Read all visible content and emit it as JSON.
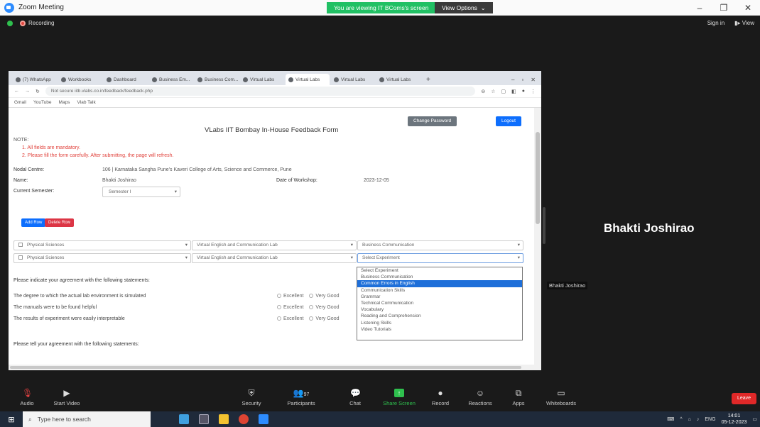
{
  "zoom": {
    "window_title": "Zoom Meeting",
    "viewing_banner": "You are viewing IT BComs's screen",
    "view_options": "View Options",
    "recording": "Recording",
    "sign_in": "Sign in",
    "view": "View",
    "speaker_name": "Bhakti Joshirao",
    "thumbnail_name": "Bhakti Joshirao",
    "toolbar": [
      {
        "label": "Audio",
        "icon": "mic-icon"
      },
      {
        "label": "Start Video",
        "icon": "video-icon"
      },
      {
        "label": "Security",
        "icon": "shield-icon"
      },
      {
        "label": "Participants",
        "icon": "participants-icon",
        "count": "97"
      },
      {
        "label": "Chat",
        "icon": "chat-icon"
      },
      {
        "label": "Share Screen",
        "icon": "share-icon"
      },
      {
        "label": "Record",
        "icon": "record-icon"
      },
      {
        "label": "Reactions",
        "icon": "reactions-icon"
      },
      {
        "label": "Apps",
        "icon": "apps-icon"
      },
      {
        "label": "Whiteboards",
        "icon": "whiteboard-icon"
      }
    ],
    "leave": "Leave"
  },
  "browser": {
    "tabs": [
      "(7) WhatsApp",
      "Workbooks",
      "Dashboard",
      "Business Em...",
      "Business Com...",
      "Virtual Labs",
      "Virtual Labs",
      "Virtual Labs",
      "Virtual Labs"
    ],
    "url": "Not secure  iitb.vlabs.co.in/feedback/feedback.php",
    "bookmarks": [
      "Gmail",
      "YouTube",
      "Maps",
      "Vlab Talk"
    ]
  },
  "form": {
    "change_password": "Change Password",
    "logout": "Logout",
    "title": "VLabs IIT Bombay In-House Feedback Form",
    "note_label": "NOTE:",
    "note_1": "1. All fields are mandatory.",
    "note_2": "2. Please fill the form carefully. After submitting, the page will refresh.",
    "nodal_label": "Nodal Centre:",
    "nodal_value": "106 | Karnataka Sangha Pune's Kaveri College of Arts, Science and Commerce, Pune",
    "name_label": "Name:",
    "name_value": "Bhakti Joshirao",
    "date_label": "Date of Workshop:",
    "date_value": "2023-12-05",
    "semester_label": "Current Semester:",
    "semester_value": "Semester I",
    "add_row": "Add Row",
    "delete_row": "Delete Row",
    "rows": [
      {
        "discipline": "Physical Sciences",
        "lab": "Virtual English and Communication Lab",
        "experiment": "Business Communication"
      },
      {
        "discipline": "Physical Sciences",
        "lab": "Virtual English and Communication Lab",
        "experiment": "Select Experiment"
      }
    ],
    "experiment_options": [
      "Select Experiment",
      "Business Communication",
      "Common Errors in English",
      "Communication Skills",
      "Grammar",
      "Technical Communication",
      "Vocabulary",
      "Reading and Comprehension",
      "Listening Skills",
      "Video Tutorials"
    ],
    "selected_option_index": 2,
    "section_1": "Please indicate your agreement with the following statements:",
    "statements": [
      "The degree to which the actual lab environment is simulated",
      "The manuals were to be found helpful",
      "The results of experiment were easily interpretable"
    ],
    "ratings": [
      "Excellent",
      "Very Good"
    ],
    "section_2": "Please tell your agreement with the following statements:"
  },
  "taskbar": {
    "search_placeholder": "Type here to search",
    "lang": "ENG",
    "time": "14:01",
    "date": "05-12-2023"
  }
}
